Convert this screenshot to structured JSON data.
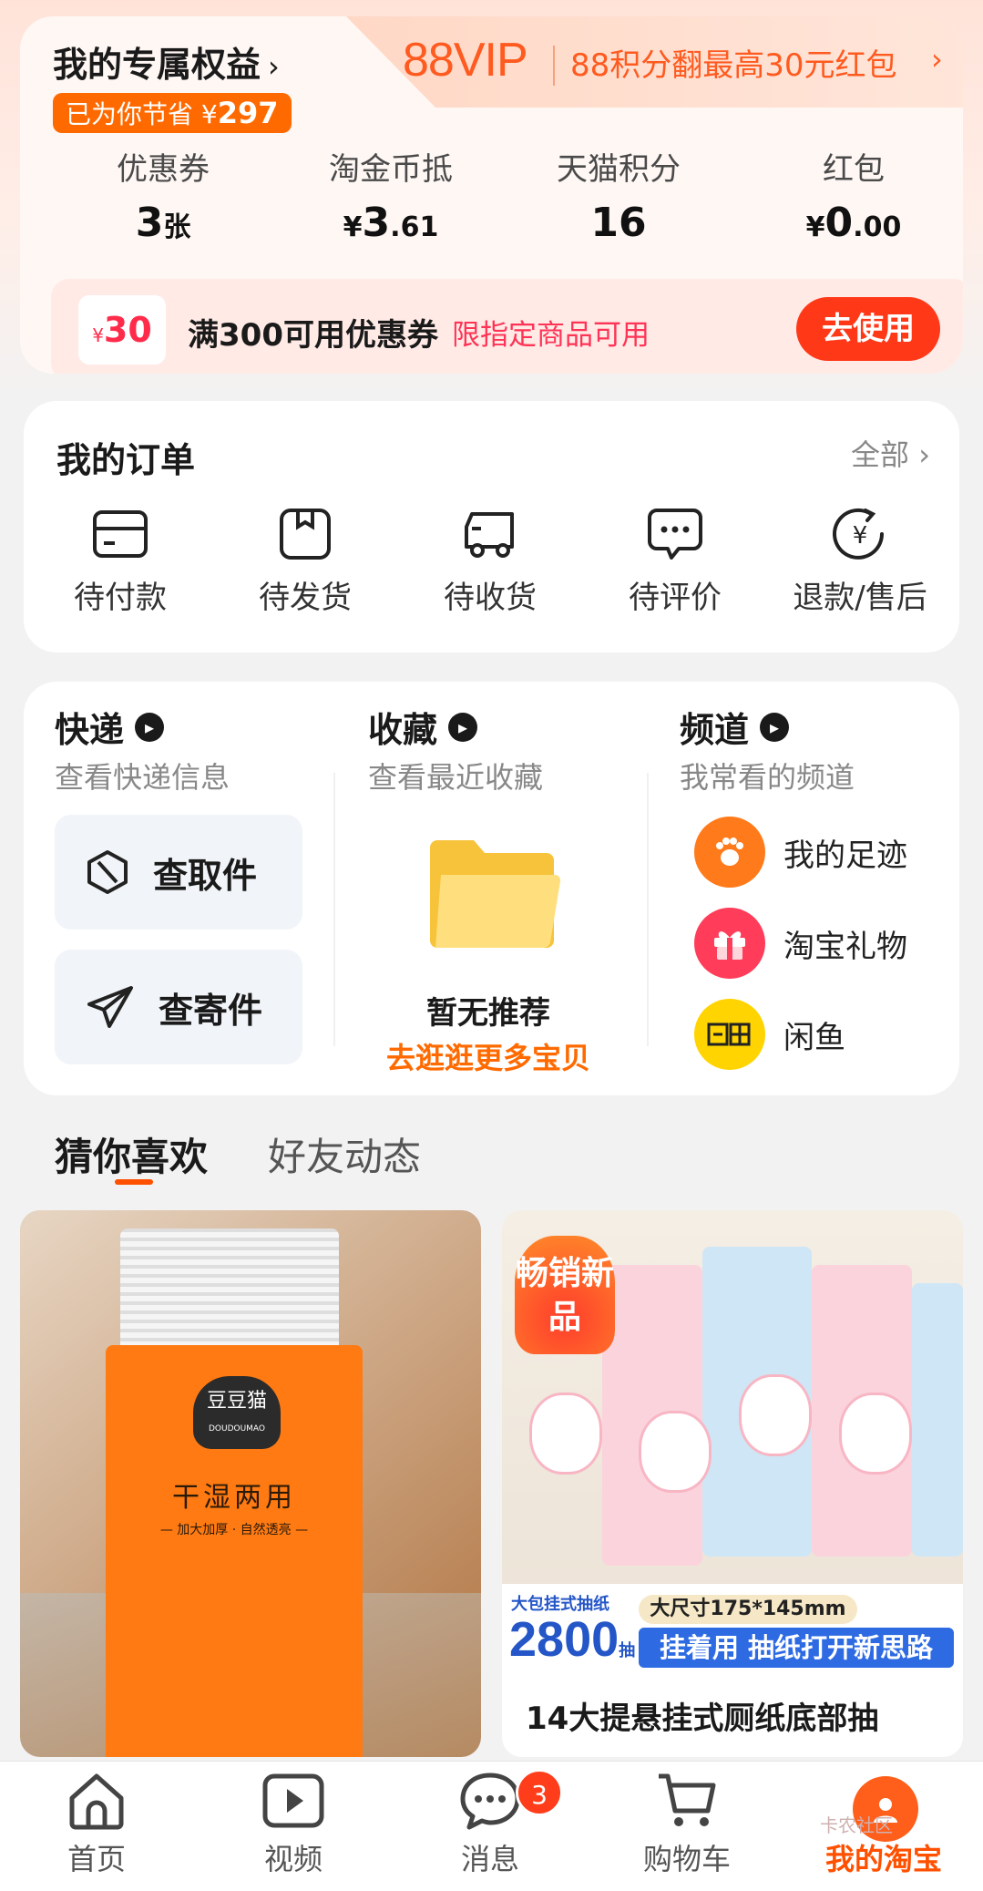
{
  "benefits": {
    "title": "我的专属权益",
    "title_chevron": "›",
    "savings_prefix": "已为你节省 ¥",
    "savings_amount": "297",
    "vip_logo": "88VIP",
    "vip_text": "88积分翻最高30元红包",
    "vip_chevron": "›",
    "stats": [
      {
        "label": "优惠券",
        "value": "3",
        "unit": "张"
      },
      {
        "label": "淘金币抵",
        "prefix": "¥",
        "value": "3",
        "unit": ".61"
      },
      {
        "label": "天猫积分",
        "value": "16"
      },
      {
        "label": "红包",
        "prefix": "¥",
        "value": "0",
        "unit": ".00"
      }
    ],
    "coupon": {
      "currency": "¥",
      "amount": "30",
      "title": "满300可用优惠券",
      "subtitle": "限指定商品可用",
      "button": "去使用"
    }
  },
  "orders": {
    "title": "我的订单",
    "all_label": "全部 ›",
    "items": [
      {
        "label": "待付款",
        "icon": "card-icon"
      },
      {
        "label": "待发货",
        "icon": "box-icon"
      },
      {
        "label": "待收货",
        "icon": "truck-icon"
      },
      {
        "label": "待评价",
        "icon": "chat-icon"
      },
      {
        "label": "退款/售后",
        "icon": "refund-icon"
      }
    ]
  },
  "services": {
    "express": {
      "title": "快递",
      "subtitle": "查看快递信息",
      "pickup": "查取件",
      "send": "查寄件"
    },
    "favorites": {
      "title": "收藏",
      "subtitle": "查看最近收藏",
      "empty_title": "暂无推荐",
      "empty_link": "去逛逛更多宝贝"
    },
    "channels": {
      "title": "频道",
      "subtitle": "我常看的频道",
      "items": [
        {
          "label": "我的足迹",
          "icon": "footprint-icon",
          "color": "#ff7a1a"
        },
        {
          "label": "淘宝礼物",
          "icon": "gift-icon",
          "color": "#ff3d5a"
        },
        {
          "label": "闲鱼",
          "icon": "xianyu-icon",
          "color": "#ffd400"
        }
      ]
    }
  },
  "feed_tabs": {
    "active": "猜你喜欢",
    "other": "好友动态"
  },
  "products": [
    {
      "brand": "豆豆猫",
      "brand_en": "DOUDOUMAO",
      "tagline": "干湿两用",
      "subline": "— 加大加厚 · 自然透亮 —"
    },
    {
      "badge": "畅销新品",
      "banner_label": "大包挂式抽纸",
      "count": "2800",
      "count_unit": "抽",
      "size": "大尺寸175*145mm",
      "slogan": "挂着用 抽纸打开新思路",
      "title": "14大提悬挂式厕纸底部抽"
    }
  ],
  "bottom_nav": {
    "items": [
      {
        "label": "首页",
        "icon": "home-icon"
      },
      {
        "label": "视频",
        "icon": "video-icon"
      },
      {
        "label": "消息",
        "icon": "message-icon",
        "badge": "3"
      },
      {
        "label": "购物车",
        "icon": "cart-icon"
      },
      {
        "label": "我的淘宝",
        "icon": "avatar-icon",
        "active": true
      }
    ],
    "watermark": "卡农社区"
  },
  "colors": {
    "accent": "#ff5000",
    "coupon_red": "#ff3818",
    "vip": "#ff5a1f"
  }
}
